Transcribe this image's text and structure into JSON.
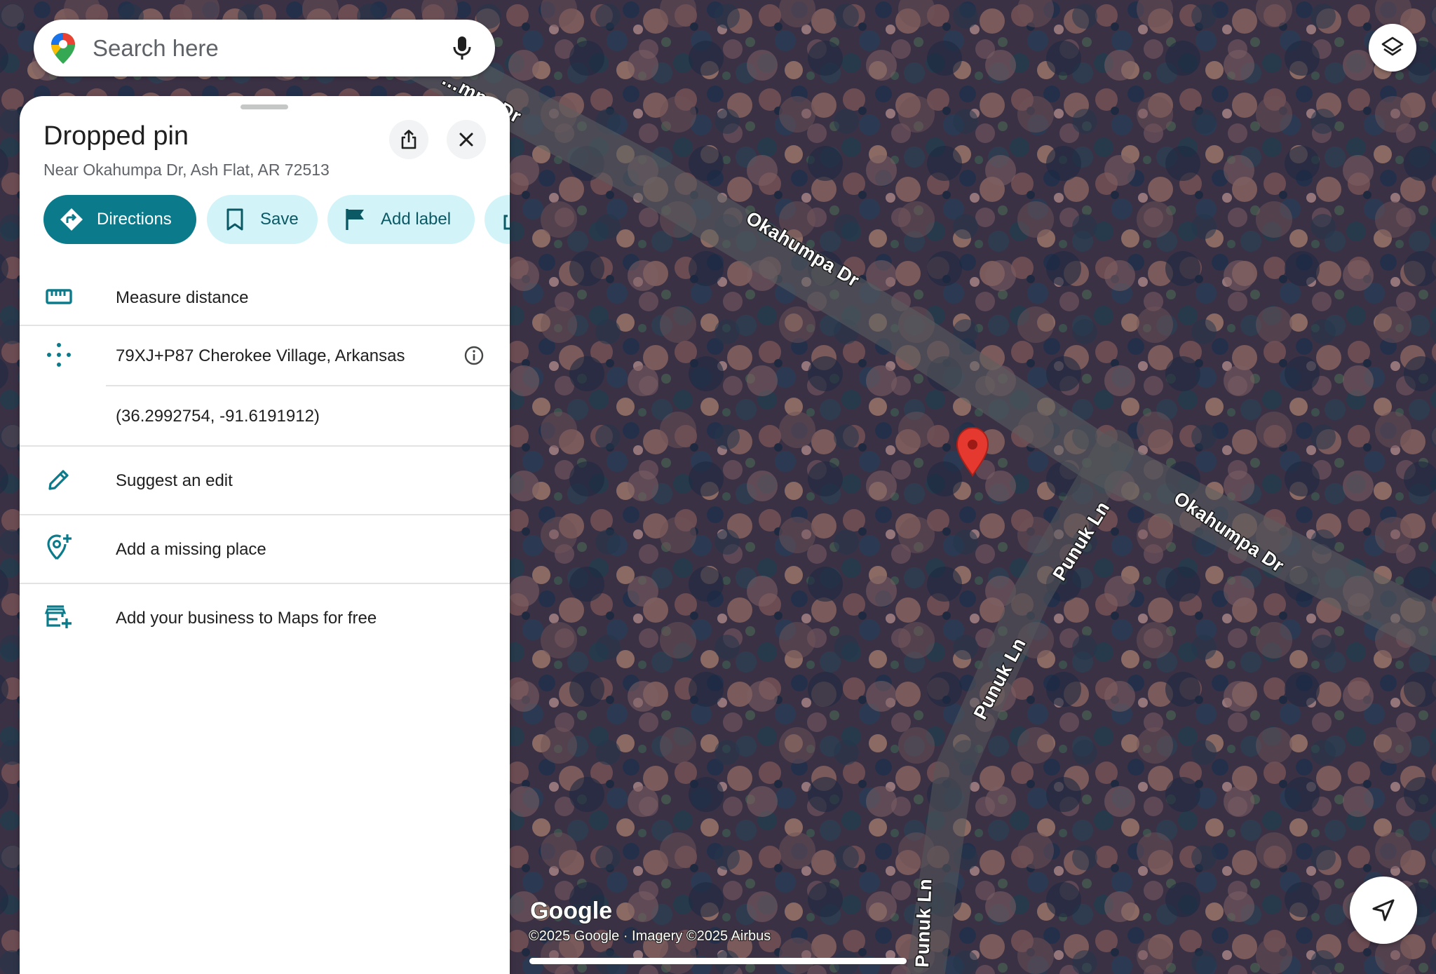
{
  "search": {
    "placeholder": "Search here",
    "logo_icon": "google-maps-pin-icon",
    "mic_icon": "microphone-icon"
  },
  "map": {
    "road_labels": {
      "okahumpa_top": "…mpa Dr",
      "okahumpa_mid": "Okahumpa Dr",
      "okahumpa_right": "Okahumpa Dr",
      "punuk_upper": "Punuk Ln",
      "punuk_mid": "Punuk Ln",
      "punuk_bottom": "Punuk Ln"
    },
    "logo": "Google",
    "attribution": "©2025 Google · Imagery ©2025 Airbus",
    "pin_color": "#e5392f"
  },
  "panel": {
    "title": "Dropped pin",
    "subtitle": "Near Okahumpa Dr, Ash Flat, AR 72513",
    "chips": {
      "directions": "Directions",
      "save": "Save",
      "add_label": "Add label"
    },
    "rows": {
      "measure": "Measure distance",
      "plus_code": "79XJ+P87 Cherokee Village, Arkansas",
      "coordinates": "(36.2992754, -91.6191912)",
      "suggest_edit": "Suggest an edit",
      "add_place": "Add a missing place",
      "add_business": "Add your business to Maps for free"
    }
  },
  "colors": {
    "accent": "#0b7b8b",
    "chip_bg": "#d2f4f8",
    "chip_text": "#0b5965",
    "icon": "#0b7b8b"
  }
}
